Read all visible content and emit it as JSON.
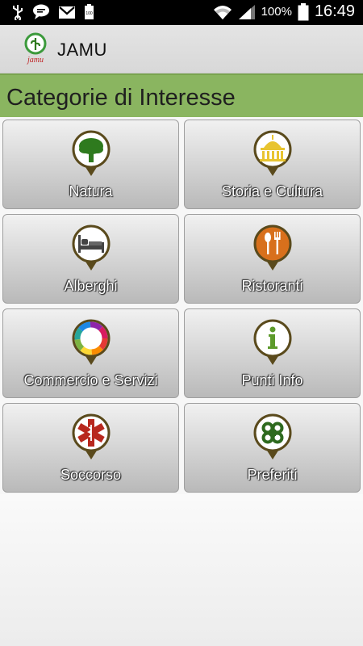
{
  "status_bar": {
    "battery_percent": "100%",
    "time": "16:49",
    "icons": [
      "usb-icon",
      "chat-icon",
      "gmail-icon",
      "battery-full-small-icon",
      "wifi-icon",
      "signal-icon",
      "battery-icon"
    ]
  },
  "app_bar": {
    "logo_text": "jamu",
    "title": "JAMU"
  },
  "section": {
    "title": "Categorie di Interesse"
  },
  "categories": [
    {
      "label": "Natura",
      "icon": "tree-icon"
    },
    {
      "label": "Storia e Cultura",
      "icon": "monument-icon"
    },
    {
      "label": "Alberghi",
      "icon": "bed-icon"
    },
    {
      "label": "Ristoranti",
      "icon": "fork-spoon-icon"
    },
    {
      "label": "Commercio e Servizi",
      "icon": "color-wheel-icon"
    },
    {
      "label": "Punti Info",
      "icon": "info-icon"
    },
    {
      "label": "Soccorso",
      "icon": "medical-star-icon"
    },
    {
      "label": "Preferiti",
      "icon": "clover-icon"
    }
  ],
  "colors": {
    "header_green": "#8ab560",
    "pin_border": "#5a4a1c",
    "tree_green": "#2e7a1e",
    "monument_yellow": "#e8c430",
    "food_orange": "#d8701c",
    "info_green": "#5c9a2a",
    "rescue_red": "#b8281e",
    "clover_green": "#2e6a1e"
  }
}
